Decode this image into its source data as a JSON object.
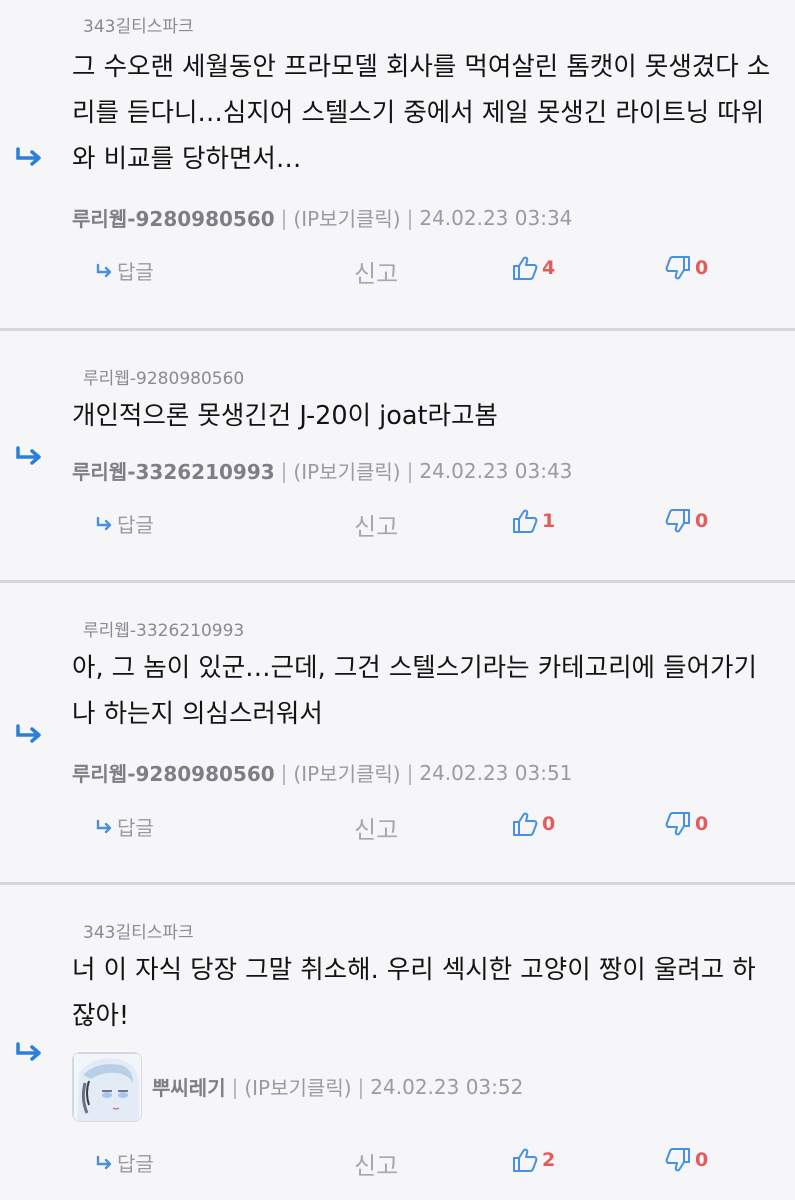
{
  "comments": [
    {
      "reply_to": "343길티스파크",
      "body": "그 수오랜 세월동안 프라모델 회사를 먹여살린 톰캣이 못생겼다 소리를 듣다니…심지어 스텔스기 중에서 제일 못생긴 라이트닝 따위와 비교를 당하면서…",
      "nickname": "루리웹-9280980560",
      "ip_label": "(IP보기클릭)",
      "timestamp": "24.02.23 03:34",
      "reply_label": "답글",
      "report_label": "신고",
      "likes": "4",
      "dislikes": "0"
    },
    {
      "reply_to": "루리웹-9280980560",
      "body": "개인적으론 못생긴건 J-20이 joat라고봄",
      "nickname": "루리웹-3326210993",
      "ip_label": "(IP보기클릭)",
      "timestamp": "24.02.23 03:43",
      "reply_label": "답글",
      "report_label": "신고",
      "likes": "1",
      "dislikes": "0"
    },
    {
      "reply_to": "루리웹-3326210993",
      "body": "아, 그 놈이 있군…근데, 그건 스텔스기라는 카테고리에 들어가기나 하는지 의심스러워서",
      "nickname": "루리웹-9280980560",
      "ip_label": "(IP보기클릭)",
      "timestamp": "24.02.23 03:51",
      "reply_label": "답글",
      "report_label": "신고",
      "likes": "0",
      "dislikes": "0"
    },
    {
      "reply_to": "343길티스파크",
      "body": "너 이 자식 당장 그말 취소해. 우리 섹시한 고양이 짱이 울려고 하잖아!",
      "nickname": "뿌씨레기",
      "ip_label": "(IP보기클릭)",
      "timestamp": "24.02.23 03:52",
      "reply_label": "답글",
      "report_label": "신고",
      "likes": "2",
      "dislikes": "0"
    }
  ],
  "icons": {
    "reply_arrow": "reply-arrow-icon",
    "thumbs_up": "thumbs-up-icon",
    "thumbs_down": "thumbs-down-icon"
  },
  "colors": {
    "accent_blue": "#2b7fdc",
    "count_red": "#e45b5b",
    "meta_gray": "#9a9aa0"
  }
}
